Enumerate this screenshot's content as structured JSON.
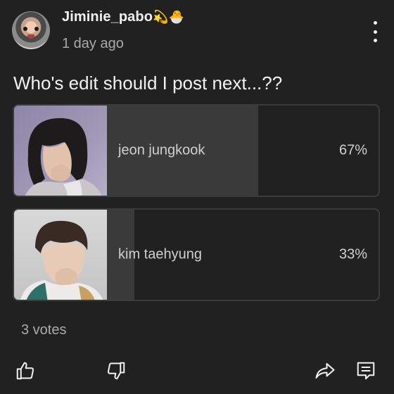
{
  "post": {
    "author": "Jiminie_pabo",
    "author_emojis": "💫🐣",
    "time": "1 day ago",
    "question": "Who's edit should I post next...??",
    "votes": "3 votes"
  },
  "poll": {
    "options": [
      {
        "label": "jeon jungkook",
        "percent": "67%",
        "fraction": 0.67
      },
      {
        "label": "kim taehyung",
        "percent": "33%",
        "fraction": 0.33
      }
    ]
  },
  "icons": {
    "menu": "more-vert-icon",
    "like": "thumb-up-icon",
    "dislike": "thumb-down-icon",
    "share": "share-icon",
    "comment": "comment-icon"
  },
  "colors": {
    "background": "#212121",
    "bar_fill": "#3a3a3a",
    "text_primary": "#f1f1f1",
    "text_secondary": "#aaaaaa"
  }
}
